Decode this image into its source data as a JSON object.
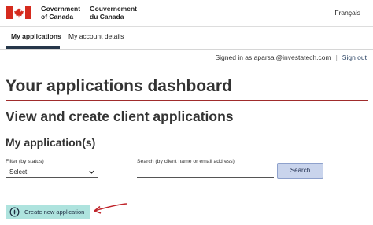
{
  "header": {
    "signature_en_line1": "Government",
    "signature_en_line2": "of Canada",
    "signature_fr_line1": "Gouvernement",
    "signature_fr_line2": "du Canada",
    "language_toggle": "Français"
  },
  "nav": {
    "tabs": [
      {
        "label": "My applications",
        "active": true
      },
      {
        "label": "My account details",
        "active": false
      }
    ]
  },
  "session": {
    "signed_in_text": "Signed in as aparsai@investatech.com",
    "separator": "|",
    "sign_out_label": "Sign out"
  },
  "page": {
    "title": "Your applications dashboard",
    "subtitle": "View and create client applications",
    "section_title": "My application(s)"
  },
  "filters": {
    "status_label": "Filter (by status)",
    "status_value": "Select",
    "search_label": "Search (by client name or email address)",
    "search_value": "",
    "search_button": "Search"
  },
  "actions": {
    "create_button": "Create new application"
  },
  "colors": {
    "flag_red": "#d52b1e",
    "title_rule": "#a02c2c",
    "search_button_bg": "#c9d4ec",
    "create_button_bg": "#aee3de",
    "annotation_arrow": "#c0252b"
  }
}
